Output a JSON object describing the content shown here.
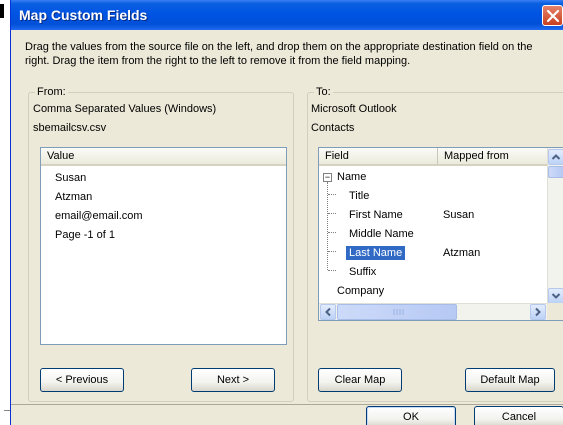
{
  "window": {
    "title": "Map Custom Fields"
  },
  "instructions": "Drag the values from the source file on the left, and drop them on the appropriate destination field on the right.  Drag the item from the right to the left to remove it from the field mapping.",
  "from": {
    "group_label": "From:",
    "source_type": "Comma Separated Values (Windows)",
    "file_name": "sbemailcsv.csv",
    "column_header": "Value",
    "values": [
      "Susan",
      "Atzman",
      "email@email.com",
      "Page -1 of 1"
    ],
    "previous_label": "< Previous",
    "next_label": "Next >"
  },
  "to": {
    "group_label": "To:",
    "app_name": "Microsoft Outlook",
    "folder_name": "Contacts",
    "headers": {
      "field": "Field",
      "mapped_from": "Mapped from"
    },
    "rows": [
      {
        "field": "Name",
        "mapped": ""
      },
      {
        "field": "Title",
        "mapped": ""
      },
      {
        "field": "First Name",
        "mapped": "Susan"
      },
      {
        "field": "Middle Name",
        "mapped": ""
      },
      {
        "field": "Last Name",
        "mapped": "Atzman"
      },
      {
        "field": "Suffix",
        "mapped": ""
      },
      {
        "field": "Company",
        "mapped": ""
      }
    ],
    "expander_glyph": "−",
    "clear_map_label": "Clear Map",
    "default_map_label": "Default Map"
  },
  "footer": {
    "ok_label": "OK",
    "cancel_label": "Cancel"
  },
  "colors": {
    "titlebar": "#0054e3",
    "selection": "#316ac5",
    "dialog_bg": "#ece9d8"
  }
}
